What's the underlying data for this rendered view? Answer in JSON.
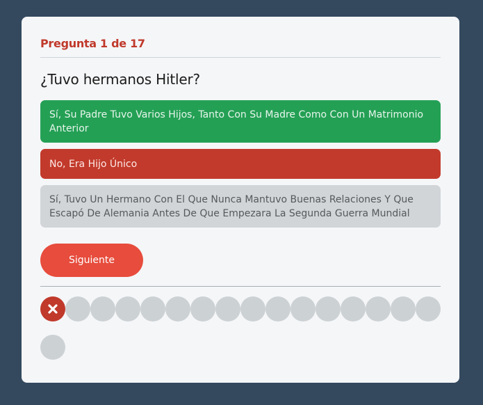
{
  "quiz": {
    "counter": "Pregunta 1 de 17",
    "question": "¿Tuvo hermanos Hitler?",
    "options": [
      {
        "label": "Sí, Su Padre Tuvo Varios Hijos, Tanto Con Su Madre Como Con Un Matrimonio Anterior",
        "state": "correct"
      },
      {
        "label": "No, Era Hijo Único",
        "state": "incorrect-selected"
      },
      {
        "label": "Sí, Tuvo Un Hermano Con El Que Nunca Mantuvo Buenas Relaciones Y Que Escapó De Alemania Antes De Que Empezara La Segunda Guerra Mundial",
        "state": "neutral"
      }
    ],
    "next_label": "Siguiente",
    "progress": {
      "total": 17,
      "answered": [
        {
          "index": 1,
          "result": "wrong",
          "icon": "x-icon"
        }
      ]
    }
  },
  "colors": {
    "background": "#34495e",
    "card": "#f5f6f8",
    "correct": "#24a055",
    "incorrect": "#c23a2b",
    "neutral": "#d1d5d8",
    "accent": "#e74c3c",
    "pending_dot": "#ccd1d4"
  }
}
